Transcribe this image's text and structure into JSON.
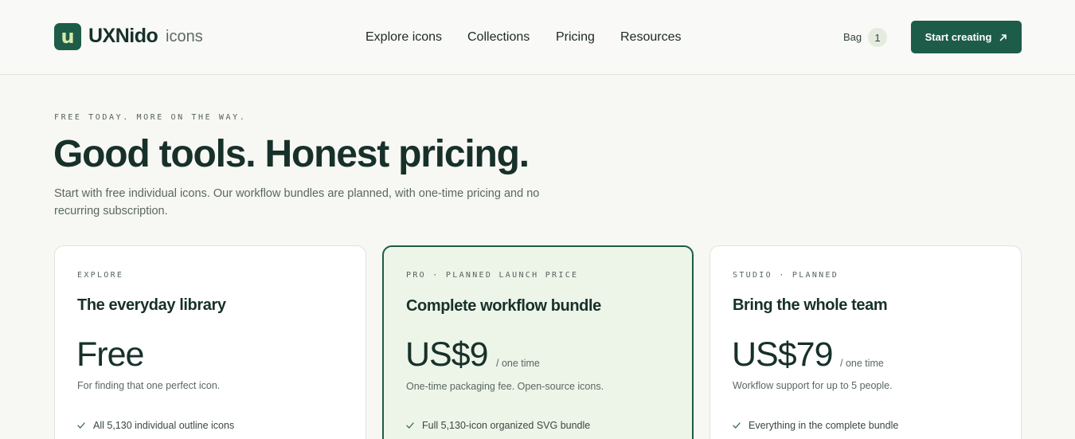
{
  "header": {
    "logo_letter": "u",
    "logo_name": "UXNido",
    "logo_suffix": "icons",
    "nav": [
      "Explore icons",
      "Collections",
      "Pricing",
      "Resources"
    ],
    "bag_label": "Bag",
    "bag_count": "1",
    "cta_label": "Start creating",
    "cta_icon": "arrow-up-right-icon"
  },
  "hero": {
    "eyebrow": "FREE TODAY. MORE ON THE WAY.",
    "headline": "Good tools. Honest pricing.",
    "subhead": "Start with free individual icons. Our workflow bundles are planned, with one-time pricing and no recurring subscription."
  },
  "plans": [
    {
      "label": "EXPLORE",
      "title": "The everyday library",
      "price": "Free",
      "period": "",
      "desc": "For finding that one perfect icon.",
      "features": [
        "All 5,130 individual outline icons"
      ]
    },
    {
      "label": "PRO · PLANNED LAUNCH PRICE",
      "title": "Complete workflow bundle",
      "price": "US$9",
      "period": "/ one time",
      "desc": "One-time packaging fee. Open-source icons.",
      "features": [
        "Full 5,130-icon organized SVG bundle"
      ]
    },
    {
      "label": "STUDIO · PLANNED",
      "title": "Bring the whole team",
      "price": "US$79",
      "period": "/ one time",
      "desc": "Workflow support for up to 5 people.",
      "features": [
        "Everything in the complete bundle"
      ]
    }
  ],
  "colors": {
    "brand": "#1d5c48",
    "background": "#f7f7f4",
    "featured_card": "#edf4e8"
  }
}
